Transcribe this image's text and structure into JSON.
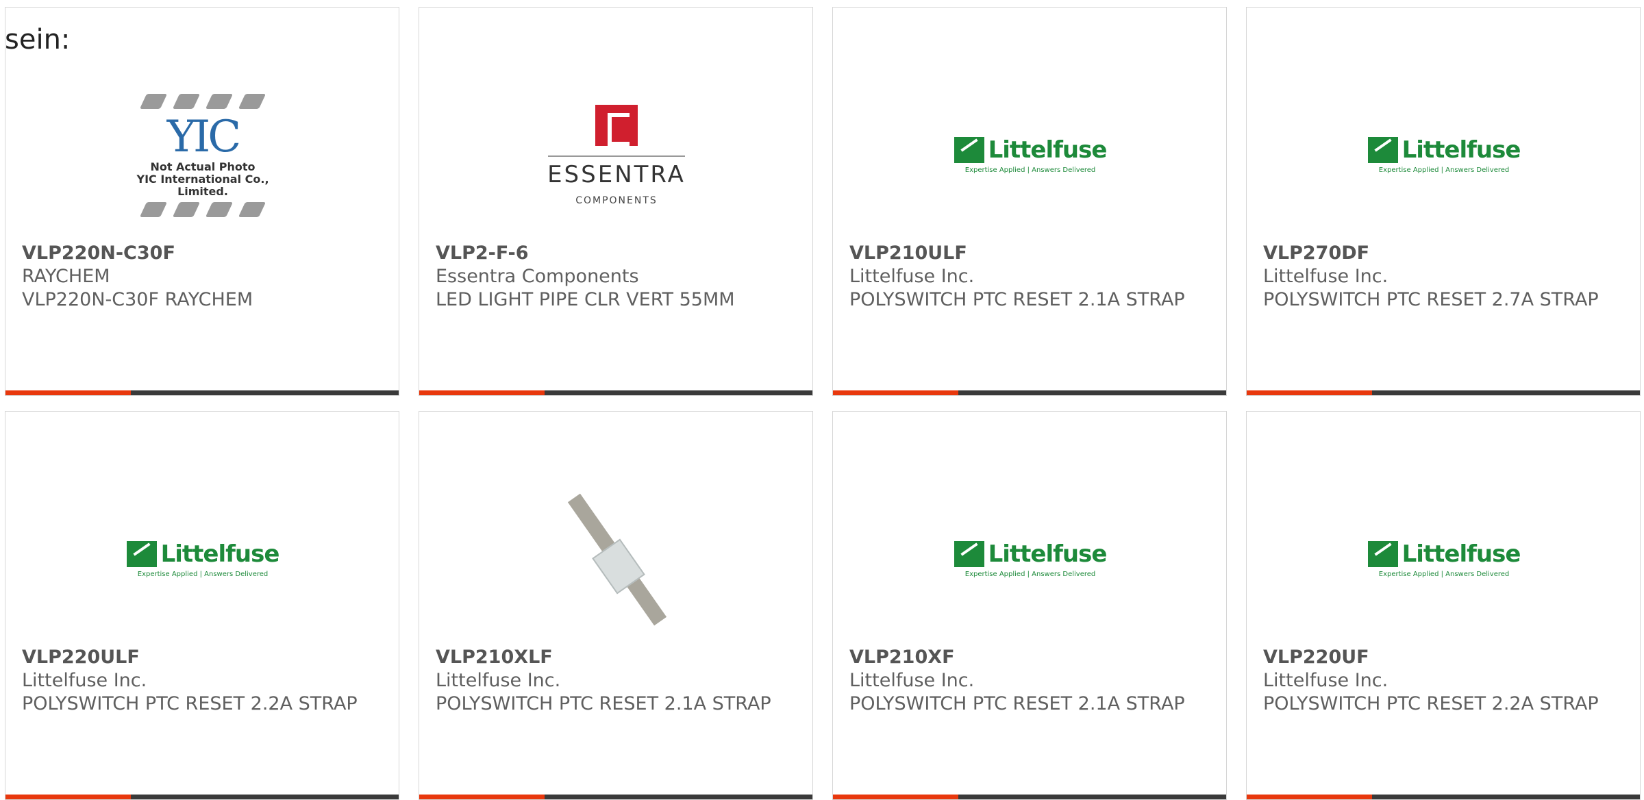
{
  "intro": "sein:",
  "products": [
    {
      "part": "VLP220N-C30F",
      "maker": "RAYCHEM",
      "desc": "VLP220N-C30F RAYCHEM",
      "image": "yic-placeholder"
    },
    {
      "part": "VLP2-F-6",
      "maker": "Essentra Components",
      "desc": "LED LIGHT PIPE CLR VERT 55MM",
      "image": "essentra-logo"
    },
    {
      "part": "VLP210ULF",
      "maker": "Littelfuse Inc.",
      "desc": "POLYSWITCH PTC RESET 2.1A STRAP",
      "image": "littelfuse-logo"
    },
    {
      "part": "VLP270DF",
      "maker": "Littelfuse Inc.",
      "desc": "POLYSWITCH PTC RESET 2.7A STRAP",
      "image": "littelfuse-logo"
    },
    {
      "part": "VLP220ULF",
      "maker": "Littelfuse Inc.",
      "desc": "POLYSWITCH PTC RESET 2.2A STRAP",
      "image": "littelfuse-logo"
    },
    {
      "part": "VLP210XLF",
      "maker": "Littelfuse Inc.",
      "desc": "POLYSWITCH PTC RESET 2.1A STRAP",
      "image": "strap-photo"
    },
    {
      "part": "VLP210XF",
      "maker": "Littelfuse Inc.",
      "desc": "POLYSWITCH PTC RESET 2.1A STRAP",
      "image": "littelfuse-logo"
    },
    {
      "part": "VLP220UF",
      "maker": "Littelfuse Inc.",
      "desc": "POLYSWITCH PTC RESET 2.2A STRAP",
      "image": "littelfuse-logo"
    }
  ],
  "logos": {
    "littelfuse_name": "Littelfuse",
    "littelfuse_tag": "Expertise Applied | Answers Delivered",
    "essentra_name": "ESSENTRA",
    "essentra_sub": "COMPONENTS",
    "yic_logo": "YIC",
    "yic_note1": "Not Actual Photo",
    "yic_note2": "YIC International Co., Limited."
  },
  "colors": {
    "accent": "#e8380d",
    "bar": "#3a3a3a",
    "littelfuse": "#1d8a3a",
    "essentra": "#d01f2e"
  }
}
